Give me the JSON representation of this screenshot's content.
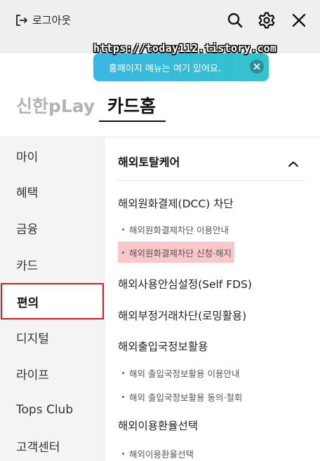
{
  "topbar": {
    "logout_label": "로그아웃",
    "icons": [
      "logout-icon",
      "search-icon",
      "gear-icon",
      "close-icon"
    ]
  },
  "watermark": "https://today112.tistory.com",
  "tooltip": {
    "text": "홈페이지 메뉴는 여기 있어요.",
    "colors": {
      "start": "#39b7e4",
      "end": "#34c3c9"
    }
  },
  "brand_tabs": {
    "items": [
      "신한pLay",
      "카드홈"
    ],
    "active": "카드홈"
  },
  "sidebar": {
    "items": [
      "마이",
      "혜택",
      "금융",
      "카드",
      "편의",
      "디지털",
      "라이프",
      "Tops Club",
      "고객센터"
    ],
    "active": "편의",
    "active_border_color": "#e0161b"
  },
  "main": {
    "section_title": "해외토탈케어",
    "menus": [
      {
        "label": "해외원화결제(DCC) 차단"
      },
      {
        "label": "해외원화결제차단 이용안내"
      },
      {
        "label": "해외원화결제차단 신청·해지",
        "highlight_color": "#f9c6c9"
      },
      {
        "label": "해외사용안심설정(Self FDS)"
      },
      {
        "label": "해외부정거래차단(로밍활용)"
      },
      {
        "label": "해외출입국정보활용"
      },
      {
        "label": "해외 출입국정보활용 이용안내"
      },
      {
        "label": "해외 출입국정보활용 동의·철회"
      },
      {
        "label": "해외이용환율선택"
      },
      {
        "label": "해외이용환율선택"
      }
    ]
  }
}
